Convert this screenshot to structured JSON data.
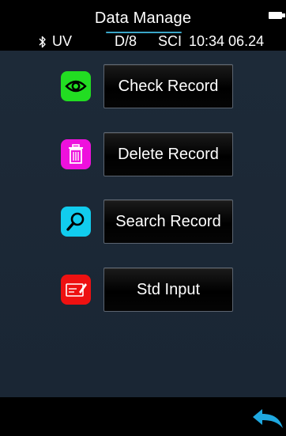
{
  "header": {
    "title": "Data Manage",
    "icons": [
      "battery-icon",
      "bluetooth-icon"
    ]
  },
  "status": {
    "bluetooth_glyph": "✱",
    "uv": "UV",
    "geometry": "D/8",
    "mode": "SCI",
    "time": "10:34 06.24"
  },
  "menu": {
    "items": [
      {
        "label": "Check Record",
        "icon": "eye-icon",
        "color": "#22dd22"
      },
      {
        "label": "Delete Record",
        "icon": "trash-icon",
        "color": "#ee11dd"
      },
      {
        "label": "Search Record",
        "icon": "magnifier-icon",
        "color": "#11ccee"
      },
      {
        "label": "Std Input",
        "icon": "card-edit-icon",
        "color": "#ee1111"
      }
    ]
  },
  "footer": {
    "back_icon": "back-arrow-icon",
    "accent": "#1fa8e0"
  },
  "colors": {
    "background": "#1c2836",
    "bar": "#000000",
    "button_border": "#5b6470"
  }
}
